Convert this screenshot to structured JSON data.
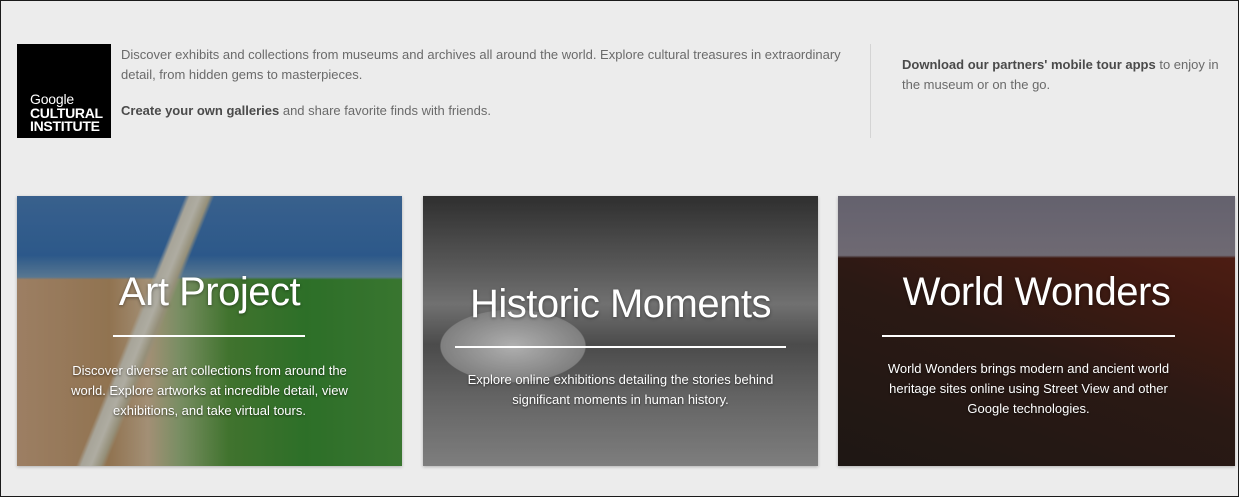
{
  "logo": {
    "line1": "Google",
    "line2": "CULTURAL",
    "line3": "INSTITUTE"
  },
  "intro": {
    "paragraph1": "Discover exhibits and collections from museums and archives all around the world. Explore cultural treasures in extraordinary detail, from hidden gems to masterpieces.",
    "galleries_link": "Create your own galleries",
    "galleries_rest": " and share favorite finds with friends."
  },
  "side": {
    "apps_link": "Download our partners' mobile tour apps",
    "apps_rest": " to enjoy in the museum or on the go."
  },
  "cards": [
    {
      "title": "Art Project",
      "description": "Discover diverse art collections from around the world. Explore artworks at incredible detail, view exhibitions, and take virtual tours."
    },
    {
      "title": "Historic Moments",
      "description": "Explore online exhibitions detailing the stories behind significant moments in human history."
    },
    {
      "title": "World Wonders",
      "description": "World Wonders brings modern and ancient world heritage sites online using Street View and other Google technologies."
    }
  ]
}
